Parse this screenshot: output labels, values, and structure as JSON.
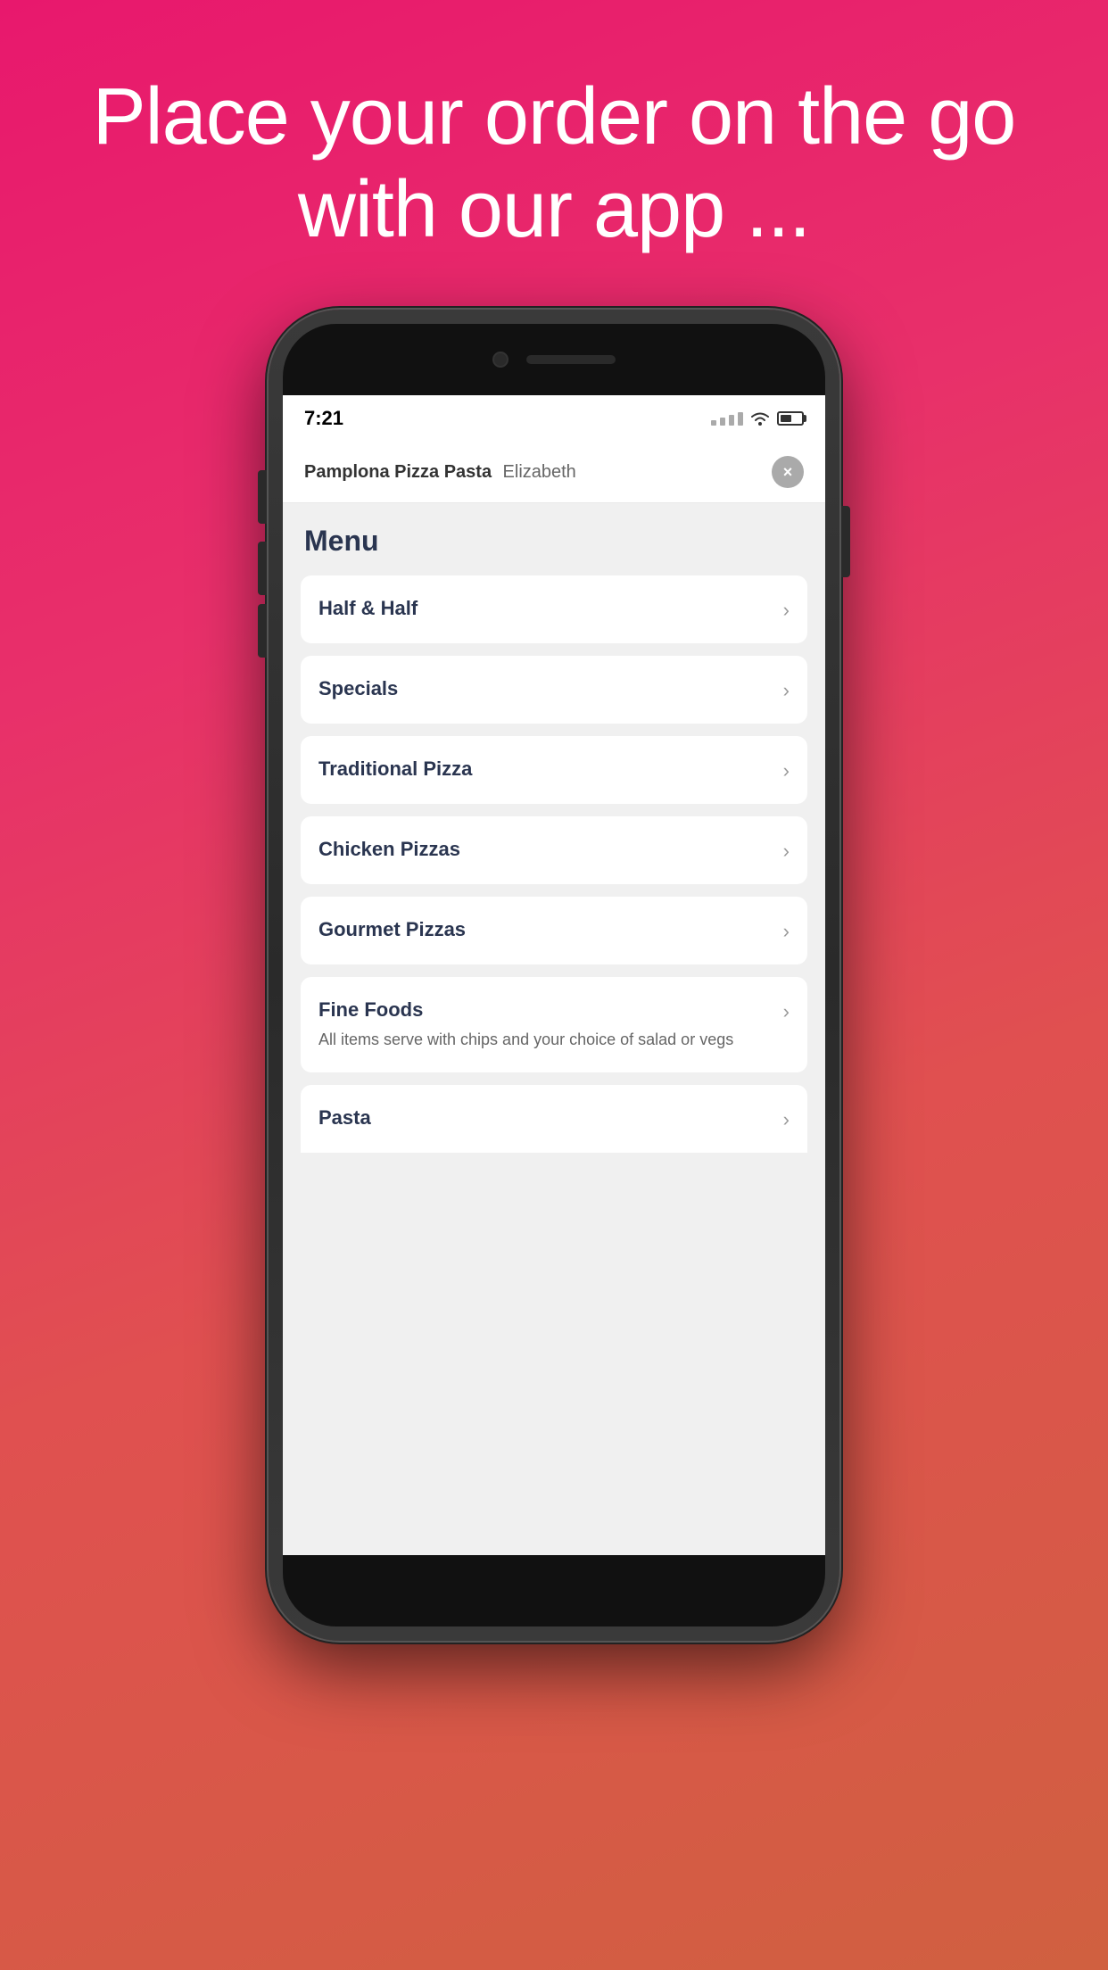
{
  "hero": {
    "tagline": "Place your order on the go with our app ..."
  },
  "status_bar": {
    "time": "7:21",
    "signal": "dots",
    "wifi": "wifi",
    "battery": "battery"
  },
  "app_nav": {
    "restaurant": "Pamplona Pizza Pasta",
    "location": "Elizabeth",
    "close_label": "×"
  },
  "menu": {
    "heading": "Menu",
    "items": [
      {
        "label": "Half & Half",
        "description": "",
        "chevron": "›"
      },
      {
        "label": "Specials",
        "description": "",
        "chevron": "›"
      },
      {
        "label": "Traditional Pizza",
        "description": "",
        "chevron": "›"
      },
      {
        "label": "Chicken Pizzas",
        "description": "",
        "chevron": "›"
      },
      {
        "label": "Gourmet Pizzas",
        "description": "",
        "chevron": "›"
      },
      {
        "label": "Fine Foods",
        "description": "All items serve with chips and  your choice of salad or vegs",
        "chevron": "›"
      },
      {
        "label": "Pasta",
        "description": "",
        "chevron": "›"
      }
    ]
  }
}
